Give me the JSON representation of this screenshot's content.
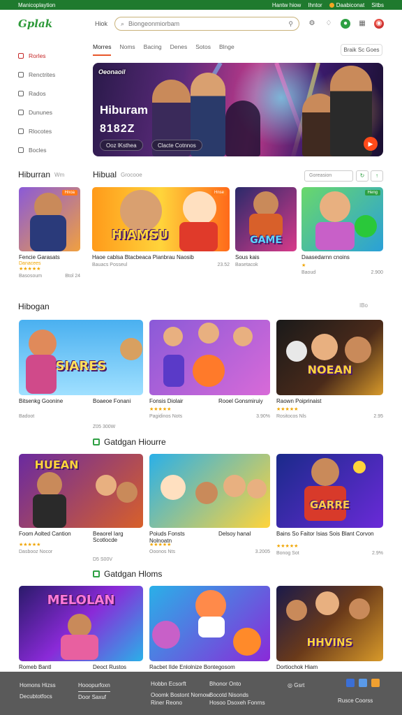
{
  "topbar": {
    "left": "Manicoplaytion",
    "right": [
      "Hantw hiow",
      "Ihntor",
      "Daabiconat",
      "Sitbs"
    ]
  },
  "header": {
    "logo": "Gplak",
    "nav": "Hiok",
    "search_placeholder": "Biongeonmiorbam"
  },
  "sidebar": {
    "items": [
      {
        "label": "Rorles",
        "active": true
      },
      {
        "label": "Renctrites",
        "active": false
      },
      {
        "label": "Rados",
        "active": false
      },
      {
        "label": "Dununes",
        "active": false
      },
      {
        "label": "Rlocotes",
        "active": false
      },
      {
        "label": "Bocles",
        "active": false
      }
    ]
  },
  "tabs": [
    {
      "label": "Morres",
      "active": true
    },
    {
      "label": "Noms",
      "active": false
    },
    {
      "label": "Bacing",
      "active": false
    },
    {
      "label": "Denes",
      "active": false
    },
    {
      "label": "Sotos",
      "active": false
    },
    {
      "label": "Blnge",
      "active": false
    }
  ],
  "tab_button": "Braik Sc Goes",
  "hero": {
    "badge": "Oeonaoil",
    "title": "Hiburam",
    "subtitle": "8182Z",
    "btn1": "Ooz lKsthea",
    "btn2": "Clacte Cotnnos"
  },
  "sections": [
    {
      "title": "Hiburran",
      "more": "Wm",
      "title2": "Hibual",
      "more2": "Grocooe",
      "sort": "Goreasion"
    },
    {
      "title": "Hibogan",
      "more": "IBo"
    },
    {
      "title": "Gatdgan Hiourre"
    },
    {
      "title": "Gatdgan Hloms"
    }
  ],
  "row1": [
    {
      "thumb": "",
      "tag": "Hnoa",
      "name": "Fencie Garasats",
      "sub": "Danacees",
      "rating": "★★★★★",
      "meta_l": "Basosoum",
      "meta_r": "Btol 24"
    },
    {
      "thumb": "HIAMSU",
      "tag": "Hnse",
      "name": "Haoe cablsa Btacbeaca Pianbrau Naosib",
      "sub": "",
      "rating": "",
      "meta_l": "Bauacs  Posseul",
      "meta_r": "23.52"
    },
    {
      "thumb": "GAME",
      "tag": "",
      "name": "Sous kais",
      "sub": "",
      "rating": "",
      "meta_l": "Basetacok",
      "meta_r": ""
    },
    {
      "thumb": "",
      "tag": "Heng",
      "name": "Daasedarnn cnoins",
      "sub": "",
      "rating": "★",
      "meta_l": "Baoud",
      "meta_r": "2.900"
    }
  ],
  "row2": [
    {
      "thumb": "SIARES",
      "name": "Bitsenkg Goonine",
      "sub": "",
      "rating": "",
      "meta_l": "Badoot",
      "meta_r": ""
    },
    {
      "thumb": "",
      "name": "Boaeoe Fonani",
      "sub": "",
      "rating": "",
      "meta_l": "Z05 300W",
      "meta_r": ""
    },
    {
      "thumb": "",
      "name": "Fonsis Diolair",
      "sub": "",
      "rating": "★★★★★",
      "meta_l": "Pagidinos  Nots",
      "meta_r": "3.90%"
    },
    {
      "thumb": "",
      "name": "Rooel Gonsmiruiy",
      "sub": "",
      "rating": "",
      "meta_l": "",
      "meta_r": ""
    },
    {
      "thumb": "NOEAN",
      "name": "Raown Poiprinaist",
      "sub": "",
      "rating": "★★★★★",
      "meta_l": "Rositocos  Nls",
      "meta_r": "2.95"
    }
  ],
  "row3": [
    {
      "thumb": "HUEAN",
      "name": "Foom Aolted Cantion",
      "sub": "",
      "rating": "★★★★★",
      "meta_l": "Dasbooz  Nocor",
      "meta_r": ""
    },
    {
      "thumb": "",
      "name": "Beaorel Iarg Scotlocde",
      "sub": "",
      "rating": "",
      "meta_l": "D5 S00V",
      "meta_r": ""
    },
    {
      "thumb": "",
      "name": "Poiuds Fonsts Nolnoatn",
      "sub": "",
      "rating": "★★★★★",
      "meta_l": "Ooonos  Nts",
      "meta_r": "3.2005"
    },
    {
      "thumb": "",
      "name": "Delsoy hanal",
      "sub": "",
      "rating": "",
      "meta_l": "",
      "meta_r": ""
    },
    {
      "thumb": "GARRE",
      "name": "Bains So Faitor Isias Sois Blant Corvon",
      "sub": "",
      "rating": "★★★★★",
      "meta_l": "Bonog Sot",
      "meta_r": "2.9%"
    }
  ],
  "row4": [
    {
      "thumb": "MELOLAN",
      "name": "Romeb Bantl"
    },
    {
      "thumb": "",
      "name": "Deoct Rustos"
    },
    {
      "thumb": "",
      "name": "Racbet IIde Enlolnize Bontegosom"
    },
    {
      "thumb": "HHVINS",
      "name": "Dortiochok Hiam"
    }
  ],
  "footer": {
    "col1": [
      "Homons Hizss",
      "Decubtotfocs"
    ],
    "col2": [
      "Hooopurfoxn",
      "Door Saxuf"
    ],
    "col3": [
      "Hobbn Ecsorft",
      "Ooomk Bostont Nornow",
      "Riner Reono"
    ],
    "col4": [
      "Bhonor Onto",
      "Bocotd Nisonds",
      "Hosoo Dsoxeh Fonrns"
    ],
    "col5": "Gsrt",
    "col6": "Rusce Coorss"
  },
  "colors": {
    "brand_green": "#1f7a2e",
    "accent": "#e8562a",
    "footer": "#5a5a5a"
  }
}
